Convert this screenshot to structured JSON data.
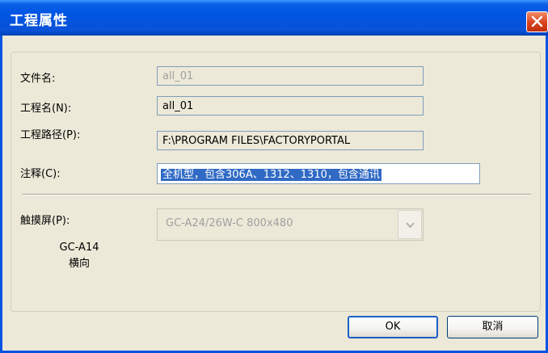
{
  "window": {
    "title": "工程属性"
  },
  "form": {
    "filename": {
      "label": "文件名:",
      "value": "all_01"
    },
    "project_name": {
      "label": "工程名(N):",
      "value": "all_01"
    },
    "project_path": {
      "label": "工程路径(P):",
      "value": "F:\\PROGRAM FILES\\FACTORYPORTAL"
    },
    "comment": {
      "label": "注释(C):",
      "value": "全机型，包含306A、1312、1310，包含通讯"
    }
  },
  "touchscreen": {
    "label": "触摸屏(P):",
    "selected": "GC-A24/26W-C 800x480",
    "preview_model": "GC-A14",
    "preview_orientation": "横向"
  },
  "buttons": {
    "ok": "OK",
    "cancel": "取消"
  },
  "colors": {
    "titlebar": "#0054e3",
    "selection": "#316ac5",
    "dialog_bg": "#ece9d8"
  }
}
